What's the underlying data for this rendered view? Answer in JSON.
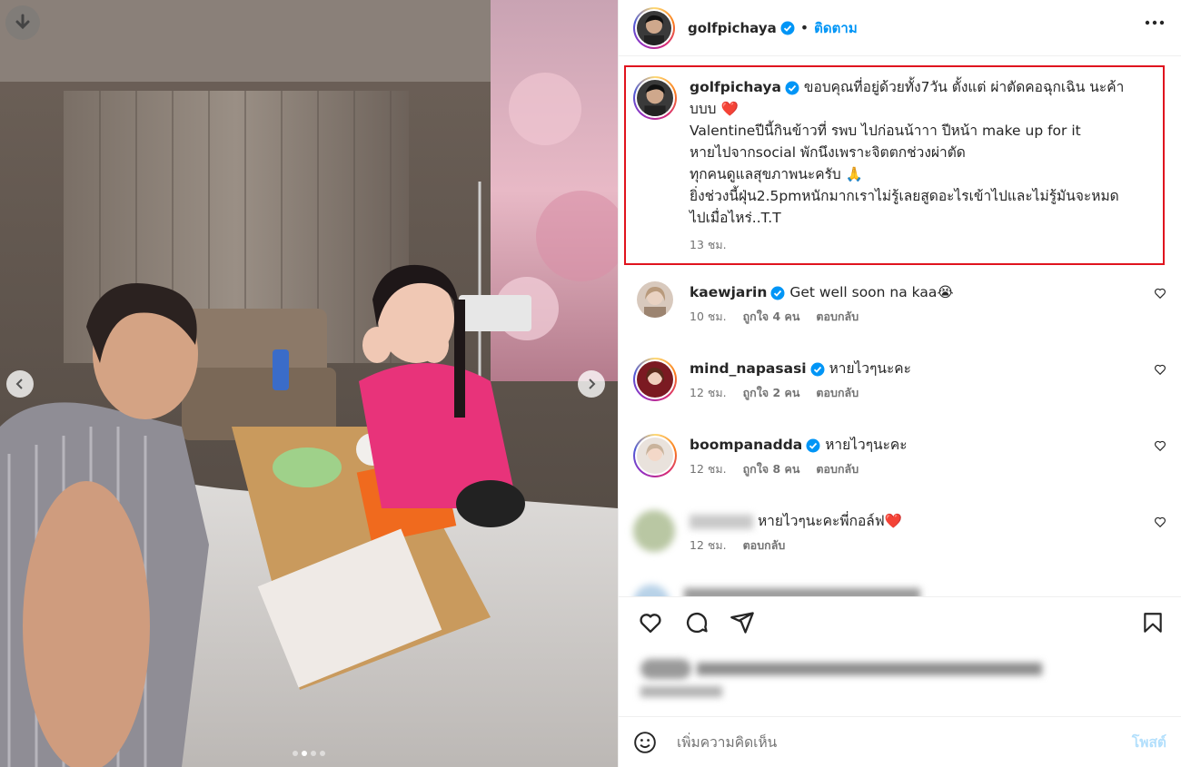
{
  "post": {
    "username": "golfpichaya",
    "follow_label": "ติดตาม",
    "caption_lines": [
      "ขอบคุณที่อยู่ด้วยทั้ง7วัน ตั้งแต่ ผ่าตัดคอฉุกเฉิน นะค้า",
      "บบบ ❤️",
      "Valentineปีนี้กินข้าวที่ รพบ ไปก่อนน้าาา ปีหน้า make up for it",
      "หายไปจากsocial พักนึงเพราะจิตตกช่วงผ่าตัด",
      "ทุกคนดูแลสุขภาพนะครับ 🙏",
      "ยิ่งช่วงนี้ฝุ่น2.5pmหนักมากเราไม่รู้เลยสูดอะไรเข้าไปและไม่รู้มันจะหมด",
      "ไปเมื่อไหร่..T.T"
    ],
    "caption_time": "13 ชม."
  },
  "comments": [
    {
      "username": "kaewjarin",
      "text": "Get well soon na kaa😭",
      "time": "10 ชม.",
      "likes": "ถูกใจ 4 คน",
      "reply": "ตอบกลับ"
    },
    {
      "username": "mind_napasasi",
      "text": "หายไวๆนะคะ",
      "time": "12 ชม.",
      "likes": "ถูกใจ 2 คน",
      "reply": "ตอบกลับ"
    },
    {
      "username": "boompanadda",
      "text": "หายไวๆนะคะ",
      "time": "12 ชม.",
      "likes": "ถูกใจ 8 คน",
      "reply": "ตอบกลับ"
    },
    {
      "username": "",
      "text": "หายไวๆนะคะพี่กอล์ฟ❤️",
      "time": "12 ชม.",
      "likes": "",
      "reply": "ตอบกลับ"
    }
  ],
  "add_comment": {
    "placeholder": "เพิ่มความคิดเห็น",
    "post_label": "โพสต์"
  },
  "colors": {
    "accent": "#0095f6",
    "highlight_border": "#e0141e",
    "verified": "#0095f6",
    "heart": "#e0141e"
  },
  "icons": [
    "download-icon",
    "chevron-left-icon",
    "chevron-right-icon",
    "verified-icon",
    "more-icon",
    "heart-icon",
    "comment-icon",
    "share-icon",
    "bookmark-icon",
    "emoji-icon"
  ]
}
